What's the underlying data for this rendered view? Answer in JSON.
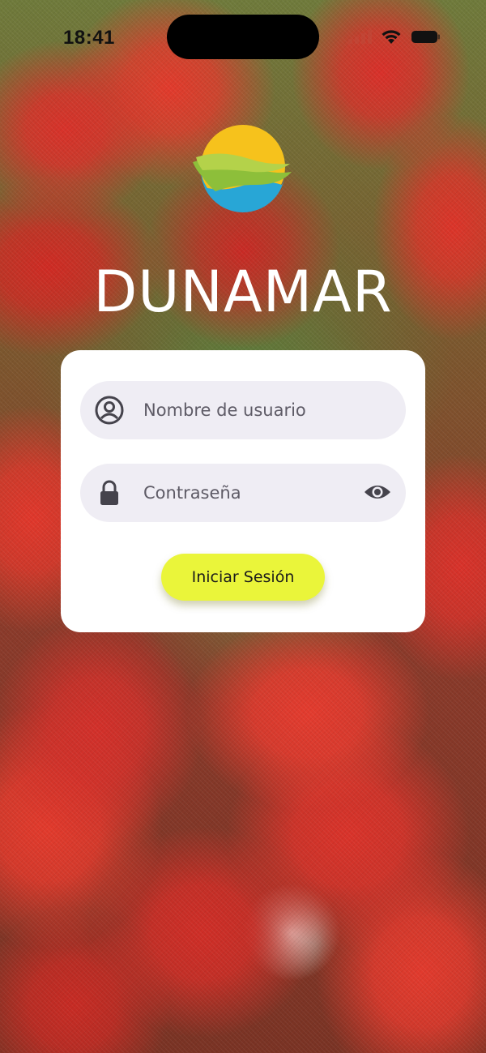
{
  "status_bar": {
    "time": "18:41",
    "icons": [
      "signal-icon",
      "wifi-icon",
      "battery-icon"
    ]
  },
  "brand": {
    "logo_icon": "dunamar-logo",
    "name": "DUNAMAR"
  },
  "login_form": {
    "username": {
      "icon": "user-circle-icon",
      "placeholder": "Nombre de usuario",
      "value": ""
    },
    "password": {
      "icon": "lock-icon",
      "placeholder": "Contraseña",
      "value": "",
      "toggle_icon": "eye-icon"
    },
    "submit_label": "Iniciar Sesión"
  },
  "colors": {
    "button_accent": "#eaf53a",
    "field_background": "#efedf4",
    "card_background": "#ffffff",
    "logo_yellow": "#f6c21c",
    "logo_green": "#8dbf3a",
    "logo_blue": "#28a6d6"
  }
}
